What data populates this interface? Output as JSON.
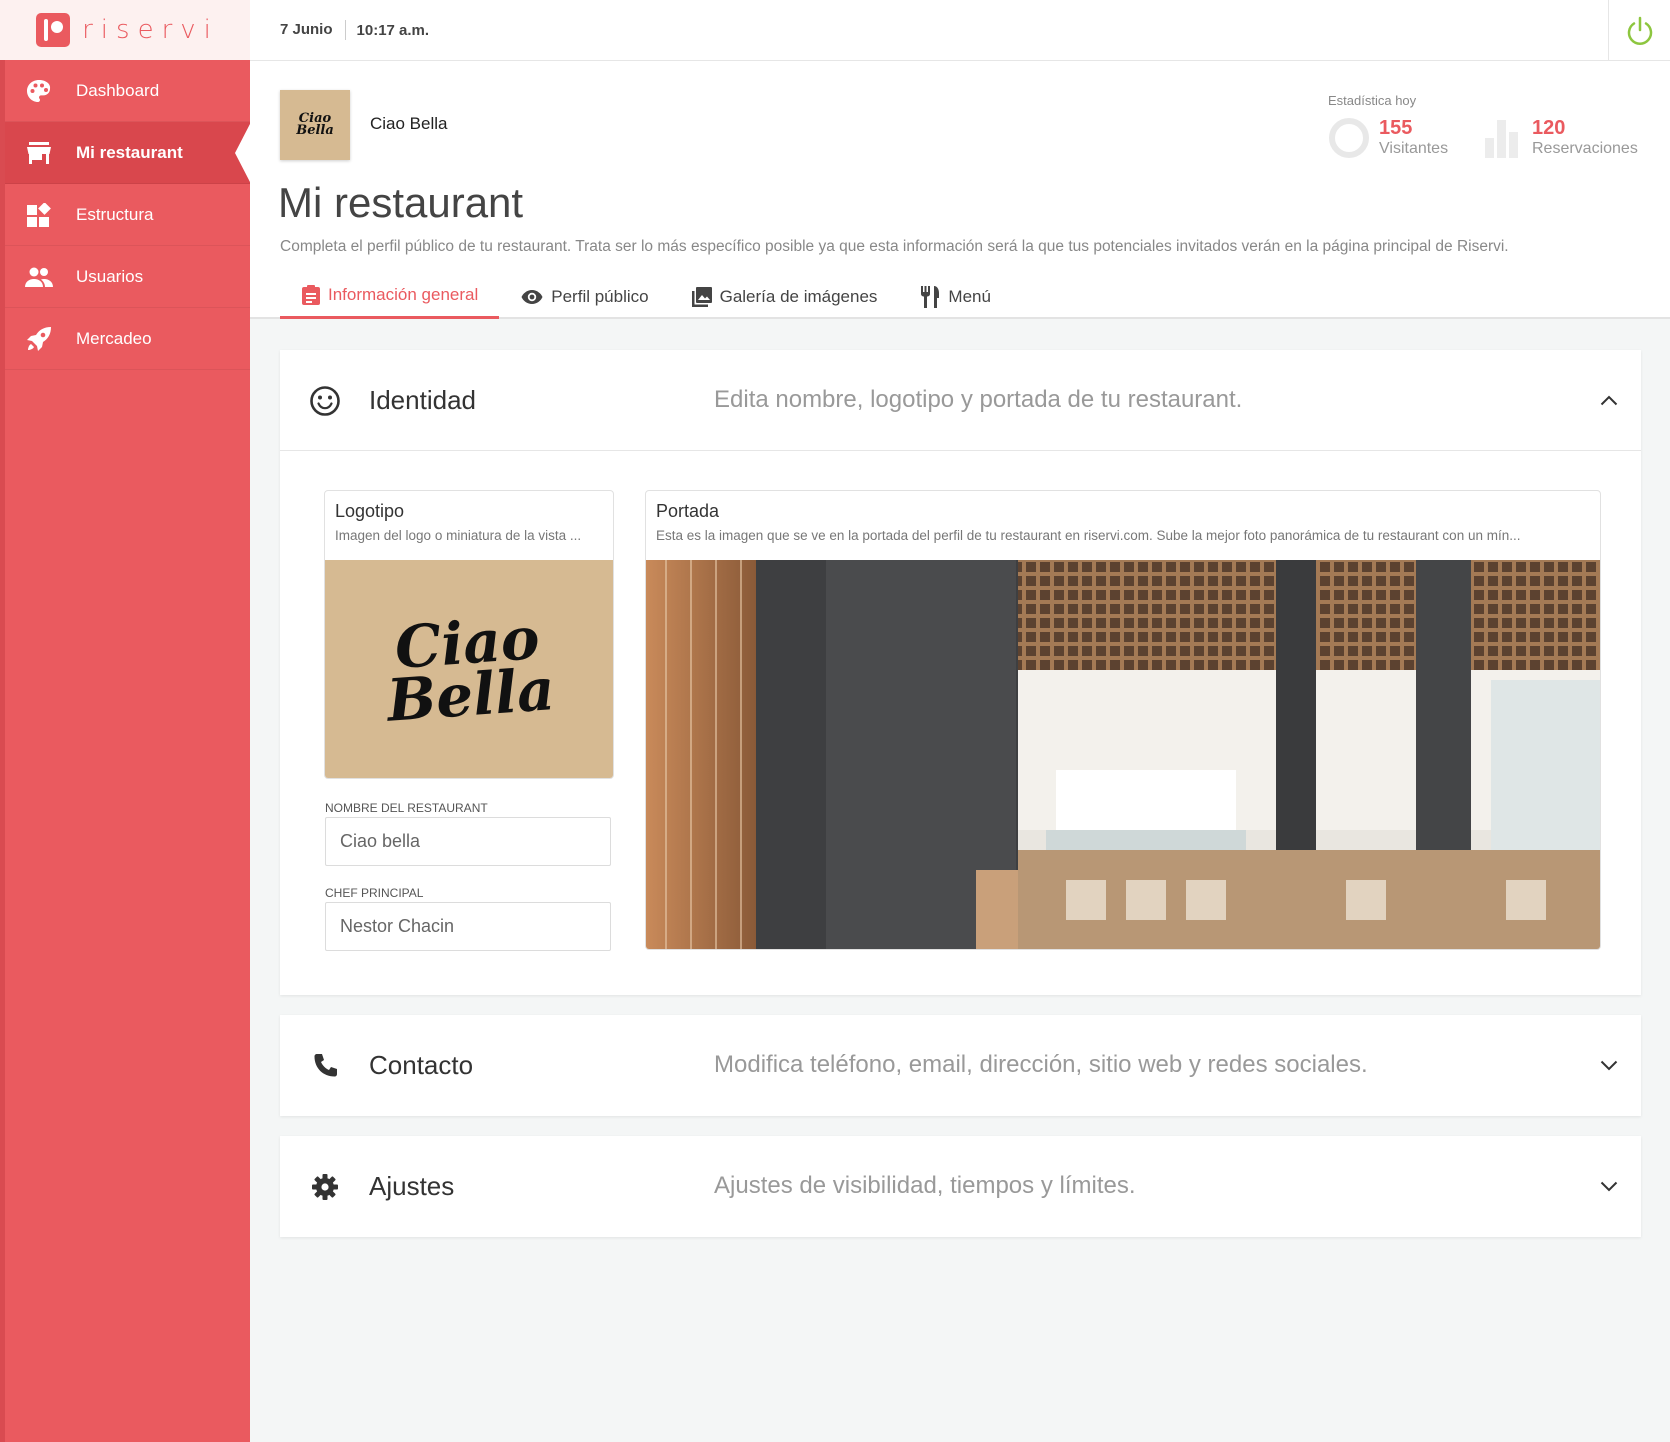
{
  "brand": {
    "name": "riservi",
    "accent": "#ea5a5f"
  },
  "topbar": {
    "date": "7 Junio",
    "time": "10:17 a.m."
  },
  "sidebar": {
    "items": [
      {
        "label": "Dashboard",
        "icon": "palette-icon"
      },
      {
        "label": "Mi restaurant",
        "icon": "store-icon",
        "active": true
      },
      {
        "label": "Estructura",
        "icon": "widgets-icon"
      },
      {
        "label": "Usuarios",
        "icon": "people-icon"
      },
      {
        "label": "Mercadeo",
        "icon": "rocket-icon"
      }
    ]
  },
  "restaurant": {
    "name": "Ciao Bella",
    "logo_text": "Ciao Bella"
  },
  "page": {
    "title": "Mi restaurant",
    "description": "Completa el perfil público de tu restaurant. Trata ser lo más específico posible ya que esta información será la que tus potenciales invitados verán en la página principal de Riservi."
  },
  "stats": {
    "title": "Estadística hoy",
    "visitors": {
      "value": "155",
      "label": "Visitantes"
    },
    "reservations": {
      "value": "120",
      "label": "Reservaciones"
    }
  },
  "tabs": [
    {
      "label": "Información general",
      "active": true
    },
    {
      "label": "Perfil público"
    },
    {
      "label": "Galería de imágenes"
    },
    {
      "label": "Menú"
    }
  ],
  "panels": {
    "identidad": {
      "title": "Identidad",
      "description": "Edita nombre, logotipo y portada de tu restaurant."
    },
    "contacto": {
      "title": "Contacto",
      "description": "Modifica teléfono, email, dirección, sitio web y redes sociales."
    },
    "ajustes": {
      "title": "Ajustes",
      "description": "Ajustes de visibilidad, tiempos y límites."
    }
  },
  "logotipo": {
    "title": "Logotipo",
    "subtitle": "Imagen del logo o miniatura de la vista ..."
  },
  "portada": {
    "title": "Portada",
    "subtitle": "Esta es la imagen que se ve en la portada del perfil de tu restaurant en riservi.com. Sube la mejor foto panorámica de tu restaurant con un mín..."
  },
  "fields": {
    "nombre": {
      "label": "NOMBRE DEL RESTAURANT",
      "value": "Ciao bella"
    },
    "chef": {
      "label": "CHEF PRINCIPAL",
      "value": "Nestor Chacin"
    }
  }
}
